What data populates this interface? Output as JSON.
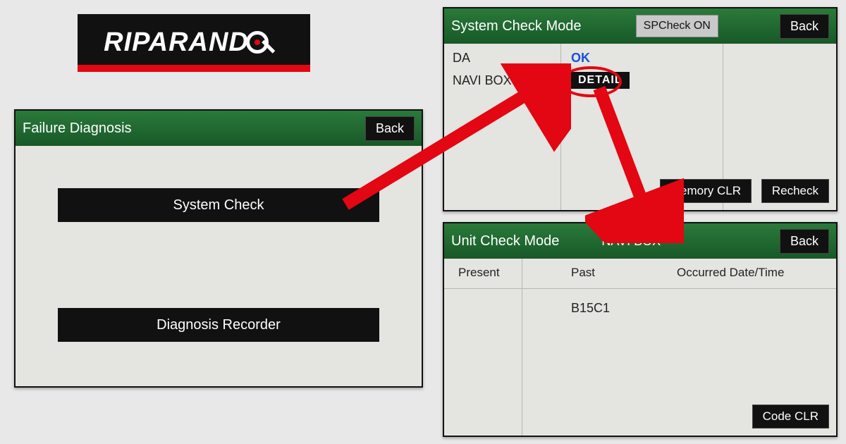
{
  "logo": {
    "text": "RIPARAND"
  },
  "panel1": {
    "title": "Failure Diagnosis",
    "back": "Back",
    "system_check": "System Check",
    "diag_recorder": "Diagnosis Recorder"
  },
  "panel2": {
    "title": "System Check Mode",
    "spcheck": "SPCheck ON",
    "back": "Back",
    "row1_label": "DA",
    "row1_val": "OK",
    "row2_label": "NAVI BOX",
    "row2_btn": "DETAIL",
    "memory_clr": "Memory CLR",
    "recheck": "Recheck"
  },
  "panel3": {
    "title": "Unit Check Mode",
    "subtitle": "NAVI BOX",
    "back": "Back",
    "th_present": "Present",
    "th_past": "Past",
    "th_occurred": "Occurred Date/Time",
    "cell_past": "B15C1",
    "code_clr": "Code CLR"
  },
  "colors": {
    "header_green": "#1f6a2f",
    "accent_red": "#e30613",
    "ok_blue": "#1a4fd8"
  }
}
